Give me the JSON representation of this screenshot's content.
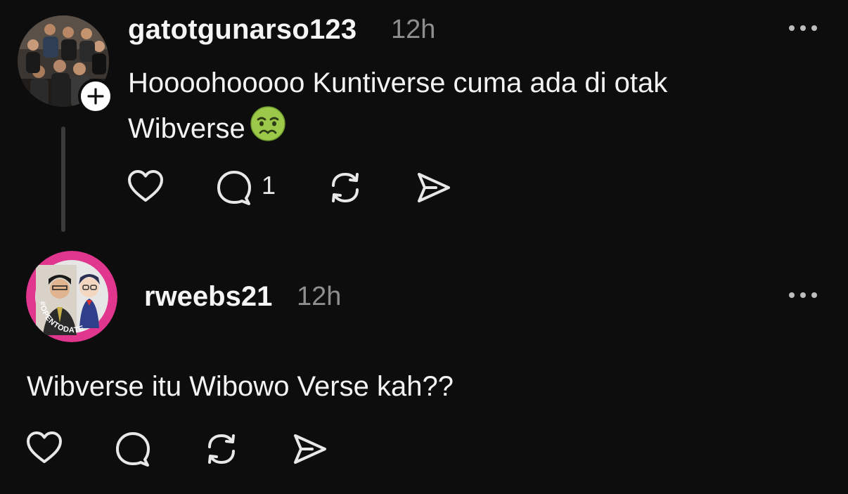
{
  "posts": [
    {
      "username": "gatotgunarso123",
      "time": "12h",
      "text_line1": "Hoooohooooo Kuntiverse cuma ada di otak",
      "text_line2": "Wibverse",
      "emoji": "nauseated-face-emoji",
      "reply_count": "1",
      "avatar": "group-photo-avatar",
      "follow_icon": "plus-icon",
      "actions": [
        "heart-icon",
        "comment-icon",
        "repost-icon",
        "share-icon"
      ]
    },
    {
      "username": "rweebs21",
      "time": "12h",
      "text": "Wibverse itu Wibowo Verse kah??",
      "avatar": "profile-photo-avatar",
      "avatar_ring_text": "#OPENTODATE",
      "avatar_ring_color": "#e0368d",
      "actions": [
        "heart-icon",
        "comment-icon",
        "repost-icon",
        "share-icon"
      ]
    }
  ],
  "colors": {
    "background": "#0d0d0d",
    "text": "#f3f3f3",
    "muted": "#8e8e8e",
    "thread_line": "#3a3a3a"
  }
}
